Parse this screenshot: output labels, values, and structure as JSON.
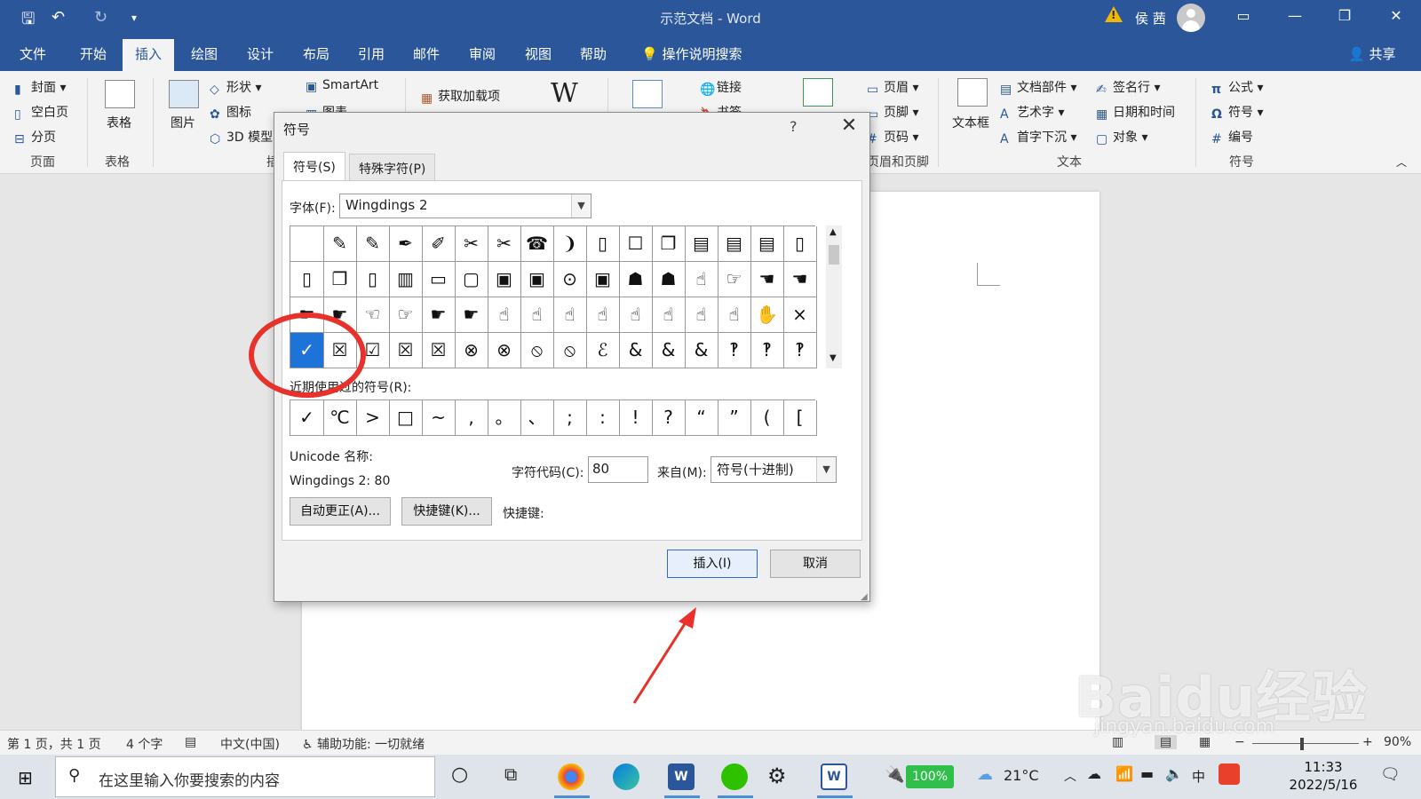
{
  "titlebar": {
    "title": "示范文档  -  Word",
    "user": "侯 茜",
    "qa_save": "🖫",
    "qa_undo": "↶",
    "qa_redo": "↻",
    "qa_more": "▾",
    "win_ribbon": "▭",
    "win_min": "—",
    "win_max": "❐",
    "win_close": "✕"
  },
  "tabs": [
    "文件",
    "开始",
    "插入",
    "绘图",
    "设计",
    "布局",
    "引用",
    "邮件",
    "审阅",
    "视图",
    "帮助"
  ],
  "tellme": "操作说明搜索",
  "share": "共享",
  "ribbon": {
    "pages": {
      "cover": "封面",
      "blank": "空白页",
      "break": "分页",
      "group": "页面"
    },
    "tables": {
      "table": "表格",
      "group": "表格"
    },
    "illustrations": {
      "picture": "图片",
      "shapes": "形状",
      "icons": "图标",
      "models": "3D 模型",
      "smartart": "SmartArt",
      "chart": "图表",
      "group": "插"
    },
    "addins": {
      "get": "获取加载项"
    },
    "links": {
      "link": "链接",
      "bookmark": "书签"
    },
    "header_footer": {
      "header": "页眉",
      "footer": "页脚",
      "page_number": "页码",
      "group": "页眉和页脚"
    },
    "text": {
      "textbox": "文本框",
      "parts": "文档部件",
      "wordart": "艺术字",
      "dropcap": "首字下沉",
      "signature": "签名行",
      "datetime": "日期和时间",
      "object": "对象",
      "group": "文本"
    },
    "symbols": {
      "equation": "公式",
      "symbol": "符号",
      "number": "编号",
      "group": "符号"
    }
  },
  "dialog": {
    "title": "符号",
    "help": "?",
    "close": "✕",
    "tab_symbols": "符号(S)",
    "tab_special": "特殊字符(P)",
    "font_label": "字体(F):",
    "font_value": "Wingdings 2",
    "grid": [
      [
        " ",
        "✎",
        "✎",
        "✒",
        "✐",
        "✂",
        "✂",
        "☎",
        "❩",
        "▯",
        "☐",
        "❐",
        "▤",
        "▤",
        "▤",
        "▯"
      ],
      [
        "▯",
        "❐",
        "▯",
        "▥",
        "▭",
        "▢",
        "▣",
        "▣",
        "⊙",
        "▣",
        "☗",
        "☗",
        "☝",
        "☞",
        "☚",
        "☚"
      ],
      [
        "☛",
        "☛",
        "☜",
        "☞",
        "☛",
        "☛",
        "☝",
        "☝",
        "☝",
        "☝",
        "☝",
        "☝",
        "☝",
        "☝",
        "✋",
        "×"
      ],
      [
        "✓",
        "☒",
        "☑",
        "☒",
        "☒",
        "⊗",
        "⊗",
        "⦸",
        "⦸",
        "ℰ",
        "&",
        "&",
        "&",
        "‽",
        "‽",
        "‽"
      ]
    ],
    "recent_label": "近期使用过的符号(R):",
    "recent": [
      "✓",
      "℃",
      ">",
      "□",
      "~",
      ",",
      "。",
      "、",
      ";",
      ":",
      "!",
      "?",
      "“",
      "”",
      "(",
      "["
    ],
    "unicode_label": "Unicode 名称:",
    "unicode_value": "Wingdings 2: 80",
    "charcode_label": "字符代码(C):",
    "charcode_value": "80",
    "from_label": "来自(M):",
    "from_value": "符号(十进制)",
    "autocorrect": "自动更正(A)...",
    "shortcut_btn": "快捷键(K)...",
    "shortcut_label": "快捷键:",
    "insert": "插入(I)",
    "cancel": "取消"
  },
  "status": {
    "page": "第 1 页，共 1 页",
    "words": "4 个字",
    "lang": "中文(中国)",
    "access": "辅助功能: 一切就绪",
    "zoom": "90%"
  },
  "taskbar": {
    "search": "在这里输入你要搜索的内容",
    "battery": "100%",
    "temp": "21°C",
    "ime": "中",
    "time": "11:33",
    "date": "2022/5/16"
  },
  "watermark": {
    "brand": "Baidu经验",
    "url": "jingyan.baidu.com"
  },
  "colors": {
    "accent": "#2b579a",
    "selected": "#1e73d9",
    "annotation": "#e8312a"
  }
}
